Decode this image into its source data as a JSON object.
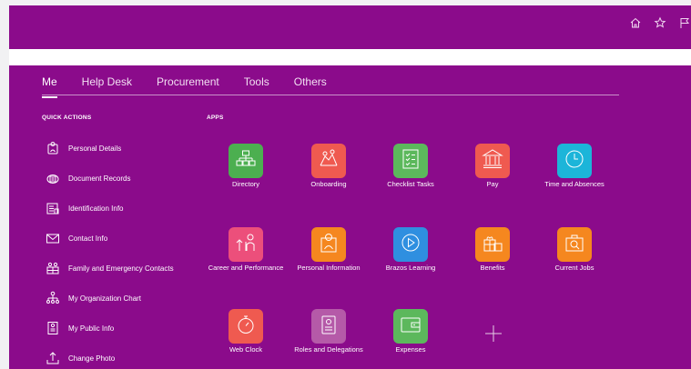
{
  "tabs": [
    "Me",
    "Help Desk",
    "Procurement",
    "Tools",
    "Others"
  ],
  "sections": {
    "quick_actions": "QUICK ACTIONS",
    "apps": "APPS"
  },
  "quick_actions": [
    {
      "label": "Personal Details",
      "icon": "person-badge-icon"
    },
    {
      "label": "Document Records",
      "icon": "document-folder-icon"
    },
    {
      "label": "Identification Info",
      "icon": "id-card-icon"
    },
    {
      "label": "Contact Info",
      "icon": "envelope-icon"
    },
    {
      "label": "Family and Emergency Contacts",
      "icon": "family-icon"
    },
    {
      "label": "My Organization Chart",
      "icon": "org-chart-icon"
    },
    {
      "label": "My Public Info",
      "icon": "public-info-icon"
    },
    {
      "label": "Change Photo",
      "icon": "photo-upload-icon"
    }
  ],
  "apps": [
    {
      "label": "Directory",
      "color": "#4caf50",
      "icon": "directory-icon"
    },
    {
      "label": "Onboarding",
      "color": "#ef5a50",
      "icon": "onboarding-icon"
    },
    {
      "label": "Checklist Tasks",
      "color": "#5cb85c",
      "icon": "checklist-icon"
    },
    {
      "label": "Pay",
      "color": "#ef5a50",
      "icon": "bank-icon"
    },
    {
      "label": "Time and Absences",
      "color": "#1cb5d9",
      "icon": "clock-icon"
    },
    {
      "label": "Career and Performance",
      "color": "#ec4f7b",
      "icon": "career-icon"
    },
    {
      "label": "Personal Information",
      "color": "#f5871f",
      "icon": "person-icon"
    },
    {
      "label": "Brazos Learning",
      "color": "#2f8fe0",
      "icon": "play-icon"
    },
    {
      "label": "Benefits",
      "color": "#f5871f",
      "icon": "benefits-icon"
    },
    {
      "label": "Current Jobs",
      "color": "#f5871f",
      "icon": "jobs-icon"
    },
    {
      "label": "Web Clock",
      "color": "#ef5a50",
      "icon": "stopwatch-icon"
    },
    {
      "label": "Roles and Delegations",
      "color": "#b55aa8",
      "icon": "badge-icon"
    },
    {
      "label": "Expenses",
      "color": "#5cb85c",
      "icon": "wallet-icon"
    }
  ],
  "add_app_icon": "plus-icon",
  "header_icons": [
    "home-icon",
    "star-icon",
    "flag-icon"
  ]
}
